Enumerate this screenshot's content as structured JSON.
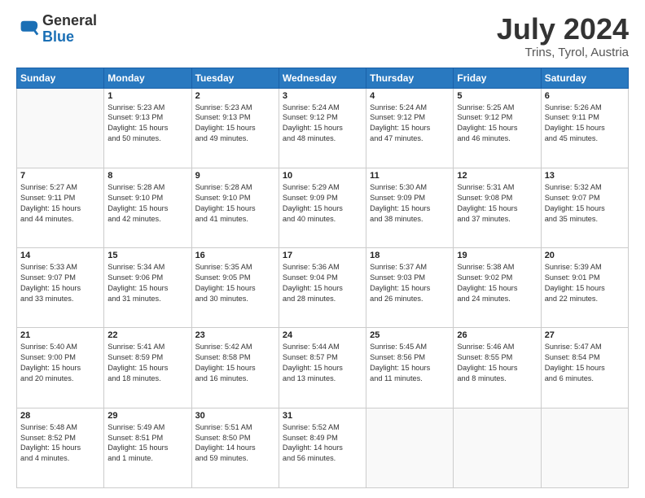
{
  "logo": {
    "general": "General",
    "blue": "Blue"
  },
  "title": "July 2024",
  "location": "Trins, Tyrol, Austria",
  "weekdays": [
    "Sunday",
    "Monday",
    "Tuesday",
    "Wednesday",
    "Thursday",
    "Friday",
    "Saturday"
  ],
  "weeks": [
    [
      {
        "day": null,
        "info": null
      },
      {
        "day": "1",
        "info": "Sunrise: 5:23 AM\nSunset: 9:13 PM\nDaylight: 15 hours\nand 50 minutes."
      },
      {
        "day": "2",
        "info": "Sunrise: 5:23 AM\nSunset: 9:13 PM\nDaylight: 15 hours\nand 49 minutes."
      },
      {
        "day": "3",
        "info": "Sunrise: 5:24 AM\nSunset: 9:12 PM\nDaylight: 15 hours\nand 48 minutes."
      },
      {
        "day": "4",
        "info": "Sunrise: 5:24 AM\nSunset: 9:12 PM\nDaylight: 15 hours\nand 47 minutes."
      },
      {
        "day": "5",
        "info": "Sunrise: 5:25 AM\nSunset: 9:12 PM\nDaylight: 15 hours\nand 46 minutes."
      },
      {
        "day": "6",
        "info": "Sunrise: 5:26 AM\nSunset: 9:11 PM\nDaylight: 15 hours\nand 45 minutes."
      }
    ],
    [
      {
        "day": "7",
        "info": "Sunrise: 5:27 AM\nSunset: 9:11 PM\nDaylight: 15 hours\nand 44 minutes."
      },
      {
        "day": "8",
        "info": "Sunrise: 5:28 AM\nSunset: 9:10 PM\nDaylight: 15 hours\nand 42 minutes."
      },
      {
        "day": "9",
        "info": "Sunrise: 5:28 AM\nSunset: 9:10 PM\nDaylight: 15 hours\nand 41 minutes."
      },
      {
        "day": "10",
        "info": "Sunrise: 5:29 AM\nSunset: 9:09 PM\nDaylight: 15 hours\nand 40 minutes."
      },
      {
        "day": "11",
        "info": "Sunrise: 5:30 AM\nSunset: 9:09 PM\nDaylight: 15 hours\nand 38 minutes."
      },
      {
        "day": "12",
        "info": "Sunrise: 5:31 AM\nSunset: 9:08 PM\nDaylight: 15 hours\nand 37 minutes."
      },
      {
        "day": "13",
        "info": "Sunrise: 5:32 AM\nSunset: 9:07 PM\nDaylight: 15 hours\nand 35 minutes."
      }
    ],
    [
      {
        "day": "14",
        "info": "Sunrise: 5:33 AM\nSunset: 9:07 PM\nDaylight: 15 hours\nand 33 minutes."
      },
      {
        "day": "15",
        "info": "Sunrise: 5:34 AM\nSunset: 9:06 PM\nDaylight: 15 hours\nand 31 minutes."
      },
      {
        "day": "16",
        "info": "Sunrise: 5:35 AM\nSunset: 9:05 PM\nDaylight: 15 hours\nand 30 minutes."
      },
      {
        "day": "17",
        "info": "Sunrise: 5:36 AM\nSunset: 9:04 PM\nDaylight: 15 hours\nand 28 minutes."
      },
      {
        "day": "18",
        "info": "Sunrise: 5:37 AM\nSunset: 9:03 PM\nDaylight: 15 hours\nand 26 minutes."
      },
      {
        "day": "19",
        "info": "Sunrise: 5:38 AM\nSunset: 9:02 PM\nDaylight: 15 hours\nand 24 minutes."
      },
      {
        "day": "20",
        "info": "Sunrise: 5:39 AM\nSunset: 9:01 PM\nDaylight: 15 hours\nand 22 minutes."
      }
    ],
    [
      {
        "day": "21",
        "info": "Sunrise: 5:40 AM\nSunset: 9:00 PM\nDaylight: 15 hours\nand 20 minutes."
      },
      {
        "day": "22",
        "info": "Sunrise: 5:41 AM\nSunset: 8:59 PM\nDaylight: 15 hours\nand 18 minutes."
      },
      {
        "day": "23",
        "info": "Sunrise: 5:42 AM\nSunset: 8:58 PM\nDaylight: 15 hours\nand 16 minutes."
      },
      {
        "day": "24",
        "info": "Sunrise: 5:44 AM\nSunset: 8:57 PM\nDaylight: 15 hours\nand 13 minutes."
      },
      {
        "day": "25",
        "info": "Sunrise: 5:45 AM\nSunset: 8:56 PM\nDaylight: 15 hours\nand 11 minutes."
      },
      {
        "day": "26",
        "info": "Sunrise: 5:46 AM\nSunset: 8:55 PM\nDaylight: 15 hours\nand 8 minutes."
      },
      {
        "day": "27",
        "info": "Sunrise: 5:47 AM\nSunset: 8:54 PM\nDaylight: 15 hours\nand 6 minutes."
      }
    ],
    [
      {
        "day": "28",
        "info": "Sunrise: 5:48 AM\nSunset: 8:52 PM\nDaylight: 15 hours\nand 4 minutes."
      },
      {
        "day": "29",
        "info": "Sunrise: 5:49 AM\nSunset: 8:51 PM\nDaylight: 15 hours\nand 1 minute."
      },
      {
        "day": "30",
        "info": "Sunrise: 5:51 AM\nSunset: 8:50 PM\nDaylight: 14 hours\nand 59 minutes."
      },
      {
        "day": "31",
        "info": "Sunrise: 5:52 AM\nSunset: 8:49 PM\nDaylight: 14 hours\nand 56 minutes."
      },
      {
        "day": null,
        "info": null
      },
      {
        "day": null,
        "info": null
      },
      {
        "day": null,
        "info": null
      }
    ]
  ]
}
